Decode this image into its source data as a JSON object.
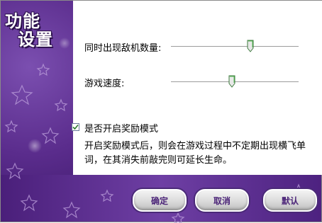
{
  "dialog": {
    "title_line1": "功能",
    "title_line2": "设置"
  },
  "settings": {
    "enemy_count": {
      "label": "同时出现敌机数量:",
      "level": 0.62
    },
    "game_speed": {
      "label": "游戏速度:",
      "level": 0.48
    },
    "reward_mode": {
      "label": "是否开启奖励模式",
      "checked": true,
      "description": "开启奖励模式后，则会在游戏过程中不定期出现横飞单词，在其消失前敲完则可延长生命。"
    }
  },
  "buttons": {
    "ok": "确定",
    "cancel": "取消",
    "default": "默认"
  },
  "colors": {
    "theme_purple": "#5a2c8c",
    "button_text": "#4b2478"
  }
}
